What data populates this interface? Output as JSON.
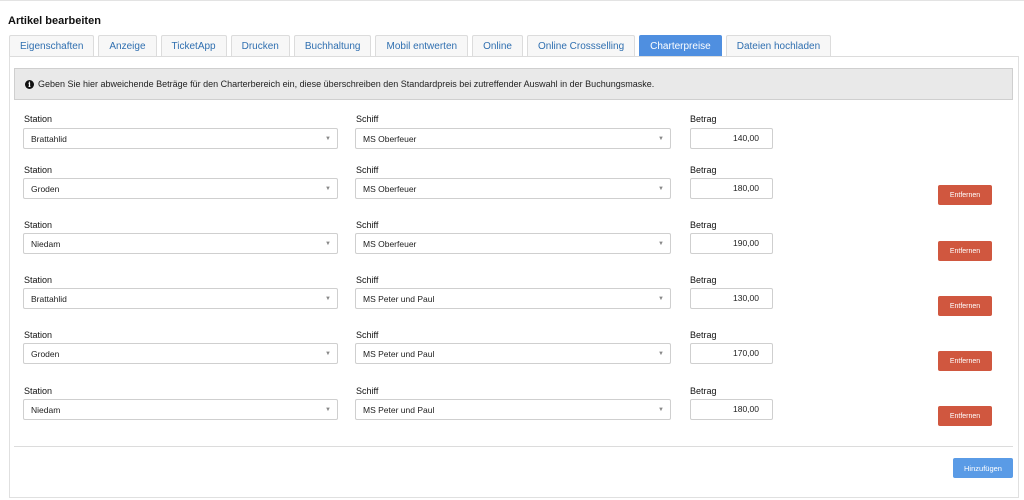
{
  "page": {
    "title": "Artikel bearbeiten"
  },
  "tabs": [
    {
      "label": "Eigenschaften"
    },
    {
      "label": "Anzeige"
    },
    {
      "label": "TicketApp"
    },
    {
      "label": "Drucken"
    },
    {
      "label": "Buchhaltung"
    },
    {
      "label": "Mobil entwerten"
    },
    {
      "label": "Online"
    },
    {
      "label": "Online Crossselling"
    },
    {
      "label": "Charterpreise"
    },
    {
      "label": "Dateien hochladen"
    }
  ],
  "active_tab": "Charterpreise",
  "info": {
    "icon": "info-icon",
    "text": "Geben Sie hier abweichende Beträge für den Charterbereich ein, diese überschreiben den Standardpreis bei zutreffender Auswahl in der Buchungsmaske."
  },
  "labels": {
    "station": "Station",
    "schiff": "Schiff",
    "betrag": "Betrag"
  },
  "rows": [
    {
      "station": "Brattahlid",
      "schiff": "MS Oberfeuer",
      "betrag": "140,00",
      "remove_label": ""
    },
    {
      "station": "Groden",
      "schiff": "MS Oberfeuer",
      "betrag": "180,00",
      "remove_label": "Entfernen"
    },
    {
      "station": "Niedam",
      "schiff": "MS Oberfeuer",
      "betrag": "190,00",
      "remove_label": "Entfernen"
    },
    {
      "station": "Brattahlid",
      "schiff": "MS Peter und Paul",
      "betrag": "130,00",
      "remove_label": "Entfernen"
    },
    {
      "station": "Groden",
      "schiff": "MS Peter und Paul",
      "betrag": "170,00",
      "remove_label": "Entfernen"
    },
    {
      "station": "Niedam",
      "schiff": "MS Peter und Paul",
      "betrag": "180,00",
      "remove_label": "Entfernen"
    }
  ],
  "add_button": {
    "label": "Hinzufügen"
  },
  "colors": {
    "active_tab": "#4f8fe0",
    "remove_button": "#d0573f",
    "add_button": "#5a9be6",
    "tab_text": "#2f6fb0"
  }
}
